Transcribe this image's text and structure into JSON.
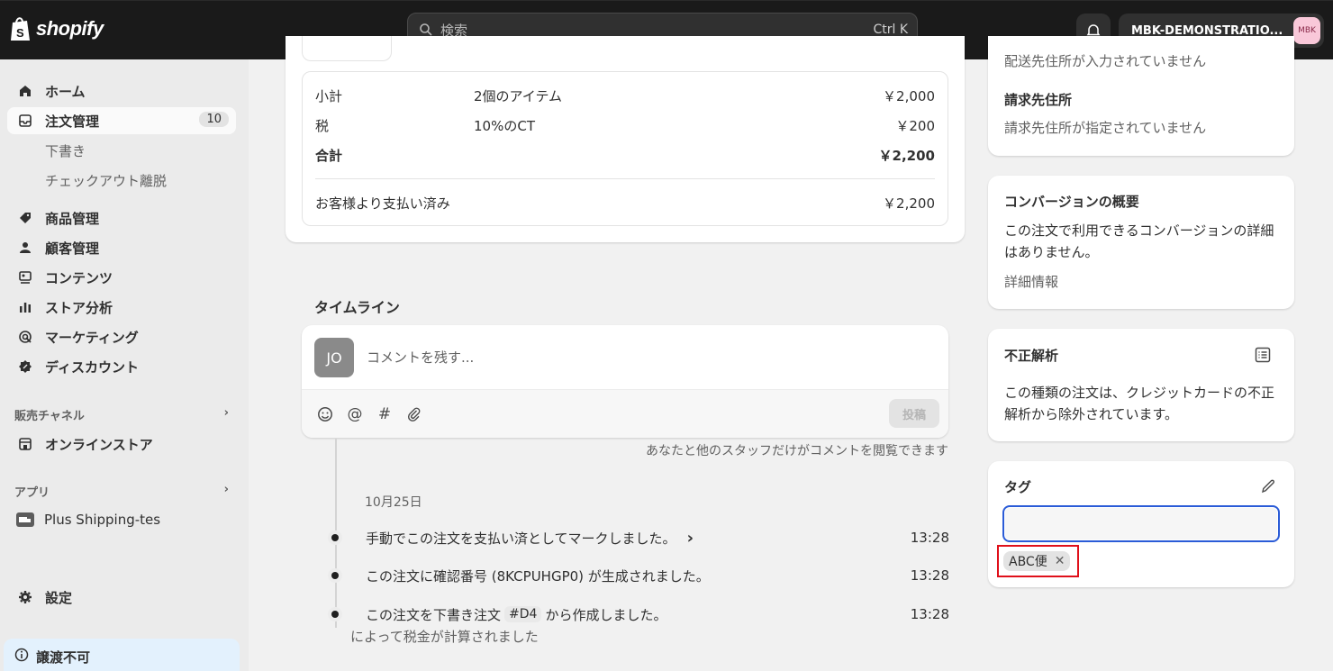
{
  "topbar": {
    "brand": "shopify",
    "search_placeholder": "検索",
    "search_shortcut": "Ctrl K",
    "store_name": "MBK-DEMONSTRATIO...",
    "store_avatar": "MBK"
  },
  "sidebar": {
    "items": [
      {
        "label": "ホーム",
        "icon": "home-icon"
      },
      {
        "label": "注文管理",
        "icon": "inbox-icon",
        "count": "10"
      },
      {
        "label": "商品管理",
        "icon": "tag-icon"
      },
      {
        "label": "顧客管理",
        "icon": "person-icon"
      },
      {
        "label": "コンテンツ",
        "icon": "content-icon"
      },
      {
        "label": "ストア分析",
        "icon": "bar-chart-icon"
      },
      {
        "label": "マーケティング",
        "icon": "target-icon"
      },
      {
        "label": "ディスカウント",
        "icon": "discount-icon"
      }
    ],
    "sub_items": [
      "下書き",
      "チェックアウト離脱"
    ],
    "sales_channels_label": "販売チャネル",
    "online_store_label": "オンラインストア",
    "apps_label": "アプリ",
    "app_item": "Plus Shipping-tes",
    "settings_label": "設定",
    "notice": "譲渡不可"
  },
  "summary": {
    "rows": [
      {
        "label": "小計",
        "desc": "2個のアイテム",
        "amount": "￥2,000"
      },
      {
        "label": "税",
        "desc": "10%のCT",
        "amount": "￥200"
      },
      {
        "label": "合計",
        "desc": "",
        "amount": "￥2,200"
      }
    ],
    "paid_label": "お客様より支払い済み",
    "paid_amount": "￥2,200"
  },
  "timeline": {
    "title": "タイムライン",
    "avatar": "JO",
    "comment_placeholder": "コメントを残す...",
    "post_button": "投稿",
    "note": "あなたと他のスタッフだけがコメントを閲覧できます",
    "date": "10月25日",
    "events": [
      {
        "text": "手動でこの注文を支払い済としてマークしました。",
        "time": "13:28"
      },
      {
        "text": "この注文に確認番号 (8KCPUHGP0) が生成されました。",
        "time": "13:28"
      },
      {
        "text_before": "この注文を下書き注文",
        "hash": "#D4",
        "text_after": "から作成しました。",
        "time": "13:28"
      }
    ],
    "partial_text": "によって税金が計算されました"
  },
  "right": {
    "shipping_partial": "配送先住所が入力されていません",
    "billing_title": "請求先住所",
    "billing_text": "請求先住所が指定されていません",
    "conversion_title": "コンバージョンの概要",
    "conversion_text": "この注文で利用できるコンバージョンの詳細はありません。",
    "conversion_link": "詳細情報",
    "fraud_title": "不正解析",
    "fraud_text": "この種類の注文は、クレジットカードの不正解析から除外されています。",
    "tags_title": "タグ",
    "tags_input_value": "",
    "tags": [
      "ABC便"
    ]
  }
}
